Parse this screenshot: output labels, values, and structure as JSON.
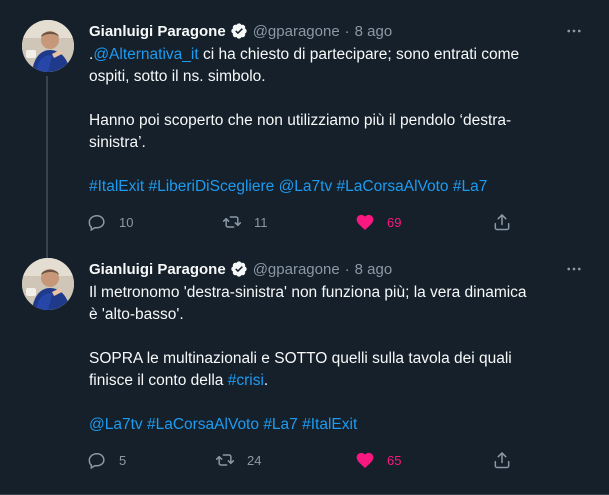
{
  "colors": {
    "background": "#15202b",
    "link": "#1d9bf0",
    "like": "#f91880",
    "muted": "#8b98a5",
    "verified": "#1d9bf0"
  },
  "tweets": [
    {
      "author": {
        "name": "Gianluigi Paragone",
        "handle": "@gparagone",
        "verified": true
      },
      "separator": "·",
      "date": "8 ago",
      "mention": "@Alternativa_it",
      "line1_prefix": ".",
      "line1_rest": " ci ha chiesto di partecipare; sono entrati come",
      "line2": "ospiti, sotto il ns. simbolo.",
      "para2_line1": "Hanno poi scoperto che non utilizziamo più il pendolo ‘destra-",
      "para2_line2": "sinistra’.",
      "hashtags": [
        "#ItalExit",
        "#LiberiDiScegliere",
        "@La7tv",
        "#LaCorsaAlVoto",
        "#La7"
      ],
      "stats": {
        "replies": "10",
        "retweets": "11",
        "likes": "69"
      },
      "liked": true
    },
    {
      "author": {
        "name": "Gianluigi Paragone",
        "handle": "@gparagone",
        "verified": true
      },
      "separator": "·",
      "date": "8 ago",
      "line1": "Il metronomo 'destra-sinistra' non funziona più; la vera dinamica",
      "line2": "è 'alto-basso'.",
      "para2_line1": "SOPRA le multinazionali e SOTTO quelli sulla tavola dei quali",
      "para2_line2_prefix": "finisce il conto della ",
      "para2_link": "#crisi",
      "para2_line2_suffix": ".",
      "hashtags": [
        "@La7tv",
        "#LaCorsaAlVoto",
        "#La7",
        "#ItalExit"
      ],
      "stats": {
        "replies": "5",
        "retweets": "24",
        "likes": "65"
      },
      "liked": true
    }
  ],
  "icons": {
    "reply": "reply-icon",
    "retweet": "retweet-icon",
    "like": "heart-icon",
    "share": "share-icon",
    "more": "more-icon",
    "verified": "verified-badge-icon"
  }
}
